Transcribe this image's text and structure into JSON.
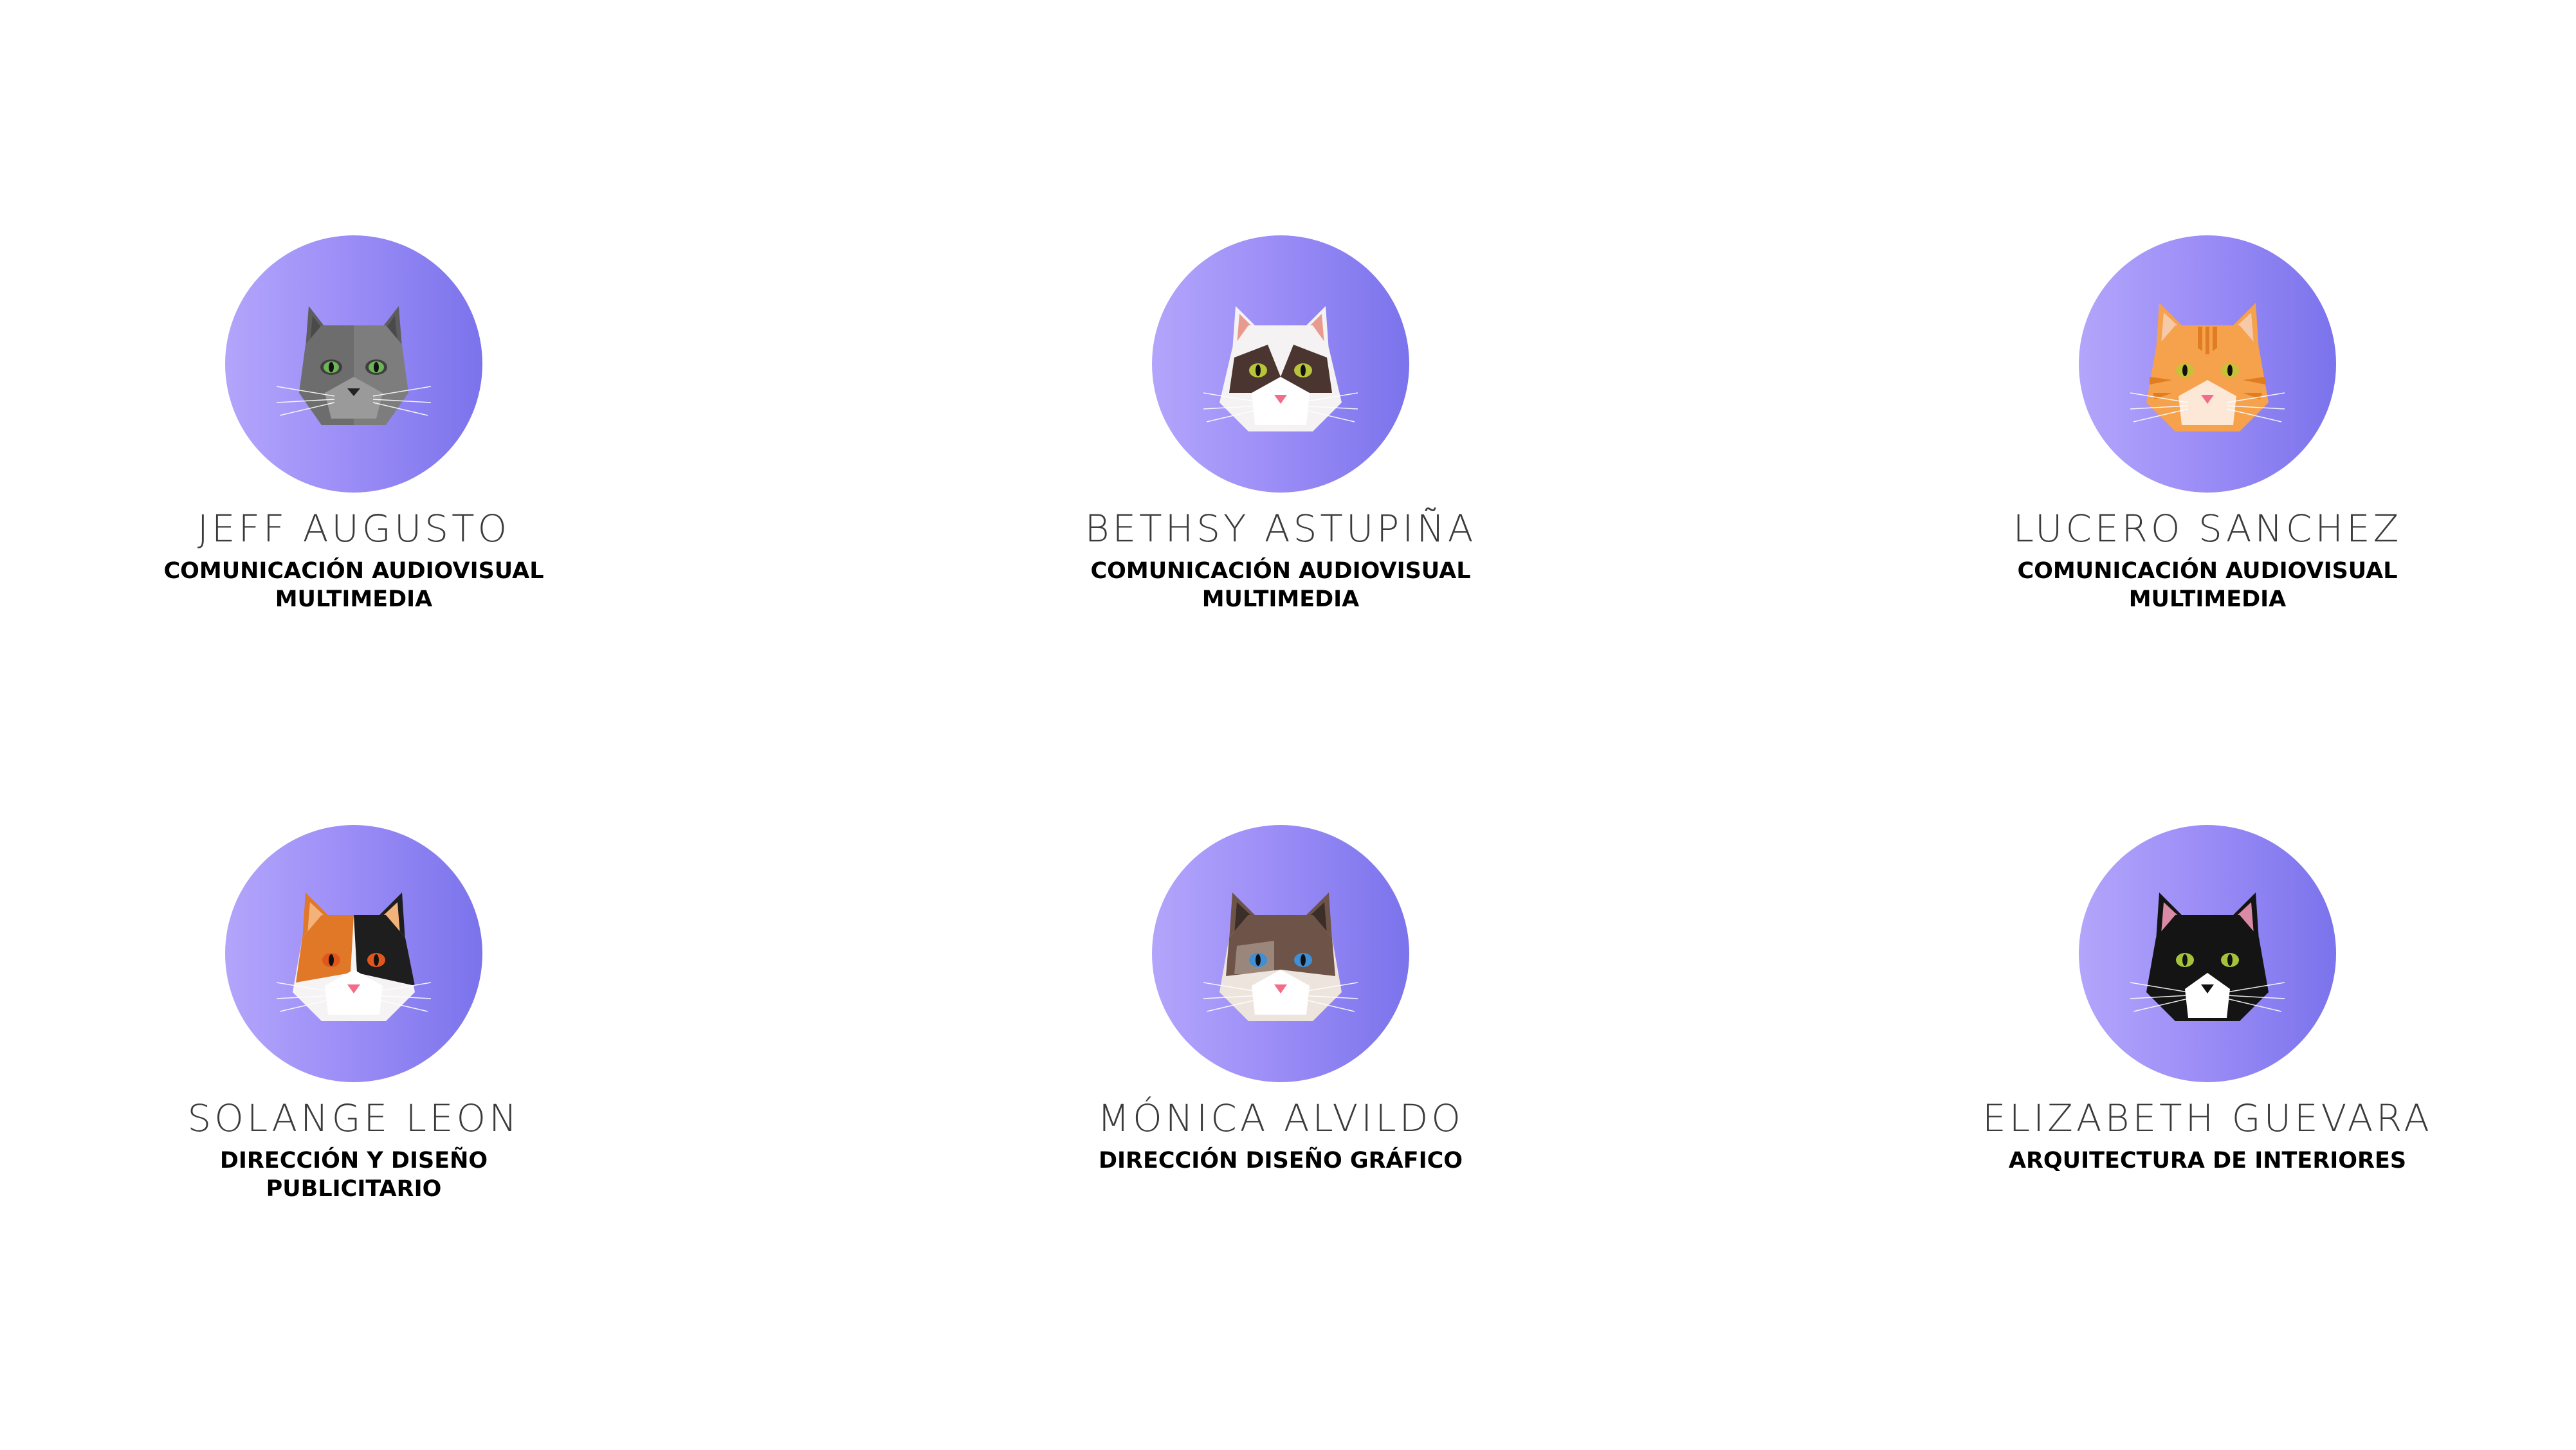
{
  "people": [
    {
      "name": "JEFF AUGUSTO",
      "career": [
        "COMUNICACIÓN AUDIOVISUAL",
        "MULTIMEDIA"
      ],
      "avatar_icon": "gray-cat-icon",
      "colors": {
        "face": "#7d7d7d",
        "face_dark": "#5d5d5d",
        "ear_inner": "#4a4a4a",
        "muzzle": "#9a9a9a",
        "eye": "#6fb35a",
        "nose": "#222222"
      }
    },
    {
      "name": "BETHSY ASTUPIÑA",
      "career": [
        "COMUNICACIÓN AUDIOVISUAL",
        "MULTIMEDIA"
      ],
      "avatar_icon": "white-brown-mask-cat-icon",
      "colors": {
        "face": "#f4f2f3",
        "face_dark": "#4a3530",
        "ear_inner": "#e99a8e",
        "muzzle": "#ffffff",
        "eye": "#b8c43a",
        "nose": "#f36c8a"
      }
    },
    {
      "name": "LUCERO SANCHEZ",
      "career": [
        "COMUNICACIÓN AUDIOVISUAL",
        "MULTIMEDIA"
      ],
      "avatar_icon": "orange-tabby-cat-icon",
      "colors": {
        "face": "#f6a14b",
        "face_dark": "#e07c22",
        "ear_inner": "#f6c9a8",
        "muzzle": "#fde8d8",
        "eye": "#c5c237",
        "nose": "#f36c8a"
      }
    },
    {
      "name": "SOLANGE LEON",
      "career": [
        "DIRECCIÓN Y DISEÑO",
        "PUBLICITARIO"
      ],
      "avatar_icon": "calico-cat-icon",
      "colors": {
        "face": "#f5f3f4",
        "face_dark": "#1e1e1e",
        "patch": "#e07828",
        "ear_inner": "#f3b27a",
        "muzzle": "#ffffff",
        "eye": "#e0571d",
        "nose": "#f36c8a"
      }
    },
    {
      "name": "MÓNICA ALVILDO",
      "career": [
        "DIRECCIÓN DISEÑO GRÁFICO"
      ],
      "avatar_icon": "brown-mask-blue-eye-cat-icon",
      "colors": {
        "face": "#ede5dd",
        "face_dark": "#6e5448",
        "ear_inner": "#3b2d28",
        "muzzle": "#ffffff",
        "eye": "#3f8fd6",
        "nose": "#f36c8a"
      }
    },
    {
      "name": "ELIZABETH GUEVARA",
      "career": [
        "ARQUITECTURA DE INTERIORES"
      ],
      "avatar_icon": "black-tuxedo-cat-icon",
      "colors": {
        "face": "#141414",
        "face_dark": "#000000",
        "ear_inner": "#d98aa5",
        "muzzle": "#ffffff",
        "eye": "#a4c33b",
        "nose": "#111111"
      }
    }
  ]
}
